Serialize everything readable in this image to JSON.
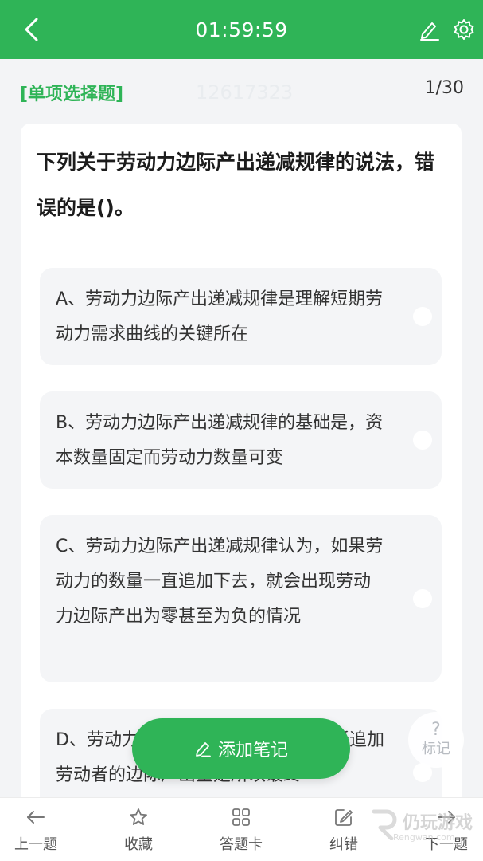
{
  "header": {
    "timer": "01:59:59"
  },
  "meta": {
    "type_label": "[单项选择题]",
    "id_text": "12617323",
    "progress": "1/30"
  },
  "question": {
    "text": "下列关于劳动力边际产出递减规律的说法，错误的是()。"
  },
  "options": [
    {
      "text": "A、劳动力边际产出递减规律是理解短期劳动力需求曲线的关键所在"
    },
    {
      "text": "B、劳动力边际产出递减规律的基础是，资本数量固定而劳动力数量可变"
    },
    {
      "text": "C、劳动力边际产出递减规律认为，如果劳动力的数量一直追加下去，就会出现劳动力边际产出为零甚至为负的情况"
    },
    {
      "text": "D、劳动力边际产出递减规律是指，新追加劳动者的边际产出量是所以最终"
    }
  ],
  "add_note": {
    "label": "添加笔记"
  },
  "mark": {
    "icon_text": "?",
    "label": "标记"
  },
  "bottom_nav": {
    "prev": "上一题",
    "favorite": "收藏",
    "answer_card": "答题卡",
    "correction": "纠错",
    "next": "下一题"
  },
  "watermark": {
    "brand": "仍玩游戏",
    "url": "Rengwan.com"
  },
  "colors": {
    "accent": "#2fb457",
    "background": "#f3f4f6",
    "option_bg": "#f4f5f7"
  }
}
